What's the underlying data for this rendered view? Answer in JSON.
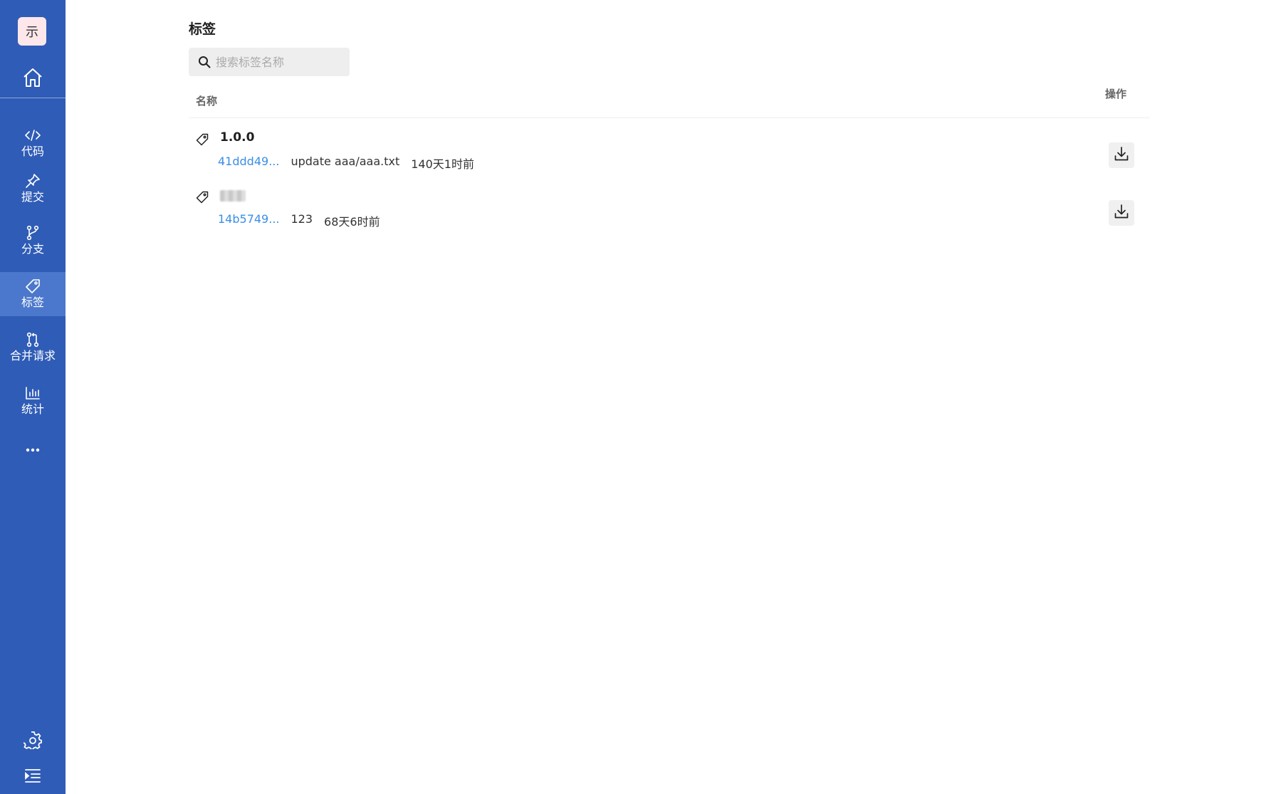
{
  "sidebar": {
    "avatar_text": "示",
    "items": [
      {
        "label": "代码",
        "icon": "code-icon"
      },
      {
        "label": "提交",
        "icon": "pin-icon"
      },
      {
        "label": "分支",
        "icon": "branch-icon"
      },
      {
        "label": "标签",
        "icon": "tag-icon",
        "active": true
      },
      {
        "label": "合并请求",
        "icon": "merge-request-icon"
      },
      {
        "label": "统计",
        "icon": "bar-chart-icon"
      }
    ],
    "accent": "#2f5cb6",
    "active_bg": "#4b78cc"
  },
  "page": {
    "title": "标签",
    "search_placeholder": "搜索标签名称"
  },
  "table": {
    "col_name": "名称",
    "col_ops": "操作",
    "rows": [
      {
        "name": "1.0.0",
        "sha": "41ddd49...",
        "message": "update aaa/aaa.txt",
        "time": "140天1时前"
      },
      {
        "name": "",
        "sha": "14b5749...",
        "message": "123",
        "time": "68天6时前"
      }
    ]
  },
  "colors": {
    "link": "#3a8ee6"
  }
}
